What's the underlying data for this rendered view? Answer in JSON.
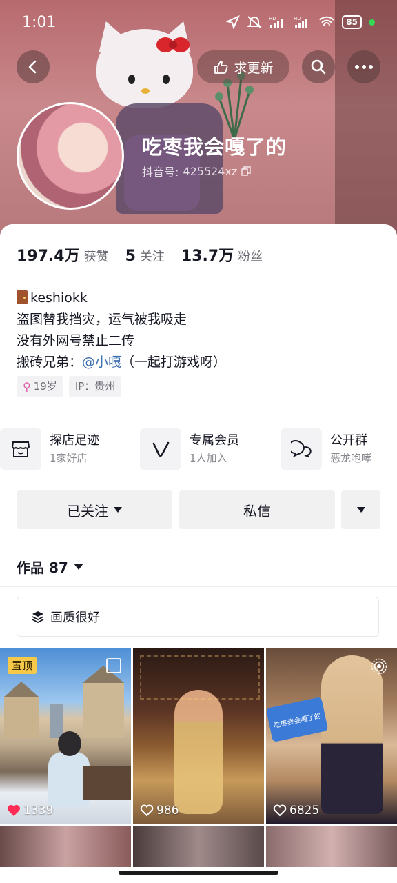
{
  "status_bar": {
    "time": "1:01",
    "battery": "85"
  },
  "header": {
    "update_label": "求更新",
    "nickname": "吃枣我会嘎了的",
    "douyin_id_label": "抖音号:",
    "douyin_id": "425524xz"
  },
  "stats": [
    {
      "value": "197.4万",
      "label": "获赞"
    },
    {
      "value": "5",
      "label": "关注"
    },
    {
      "value": "13.7万",
      "label": "粉丝"
    }
  ],
  "bio": {
    "line1": "keshiokk",
    "line2": "盗图替我挡灾，运气被我吸走",
    "line3": "没有外网号禁止二传",
    "line4_prefix": "搬砖兄弟：",
    "line4_mention": "@小嘎",
    "line4_suffix": "（一起打游戏呀）"
  },
  "tags": {
    "age": "19岁",
    "ip": "IP：贵州"
  },
  "features": [
    {
      "title": "探店足迹",
      "sub": "1家好店",
      "icon": "shop-icon"
    },
    {
      "title": "专属会员",
      "sub": "1人加入",
      "icon": "vip-v-icon"
    },
    {
      "title": "公开群",
      "sub": "恶龙咆哮",
      "icon": "group-chat-icon"
    }
  ],
  "actions": {
    "follow": "已关注",
    "message": "私信"
  },
  "works": {
    "label": "作品 87",
    "collection": "画质很好"
  },
  "videos": [
    {
      "likes": "1339",
      "pinned": "置顶",
      "liked": true
    },
    {
      "likes": "986",
      "liked": false
    },
    {
      "likes": "6825",
      "liked": false,
      "overlay_text": "吃枣我会嘎了的"
    }
  ],
  "colors": {
    "accent_like": "#fe2c55",
    "mention": "#3e6fb0",
    "pin_bg": "#f7c948"
  }
}
